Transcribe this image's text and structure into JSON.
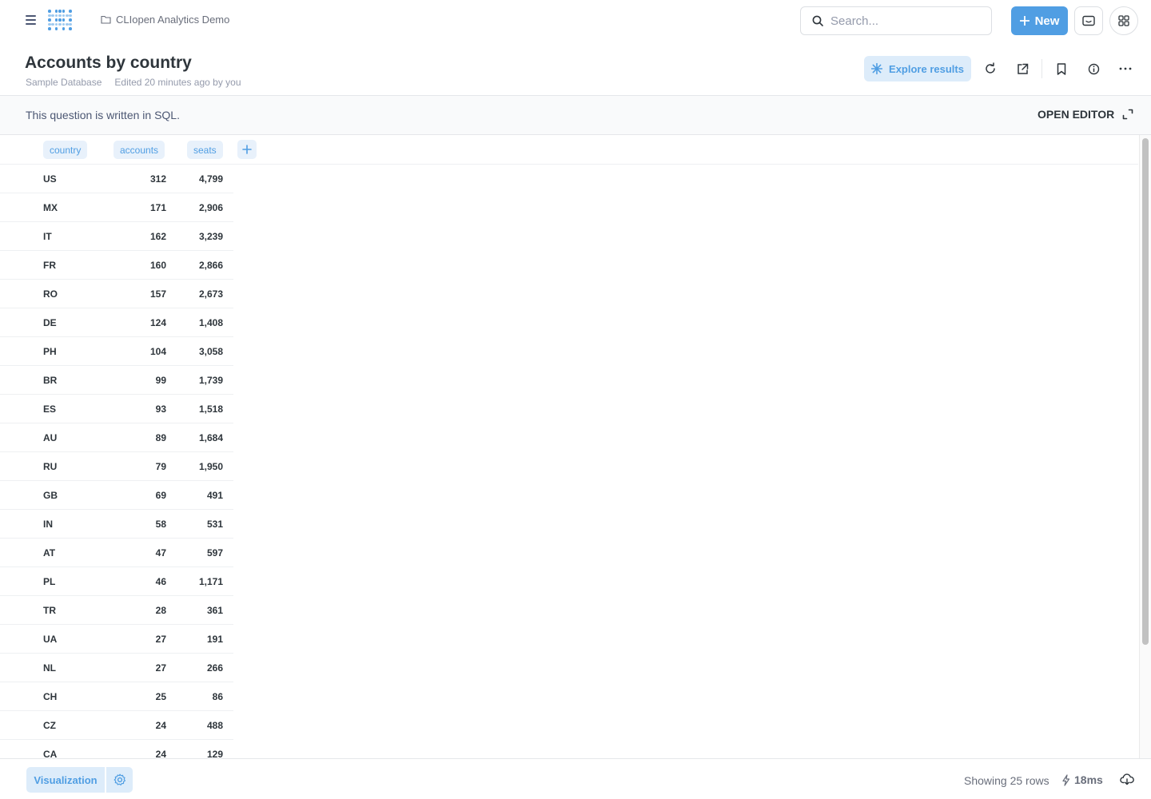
{
  "topbar": {
    "breadcrumb": "CLIopen Analytics Demo",
    "search_placeholder": "Search...",
    "new_label": "New"
  },
  "header": {
    "title": "Accounts by country",
    "database": "Sample Database",
    "edited": "Edited 20 minutes ago by you",
    "explore_label": "Explore results"
  },
  "sql_notice": {
    "text": "This question is written in SQL.",
    "open_editor": "OPEN EDITOR"
  },
  "table": {
    "columns": [
      "country",
      "accounts",
      "seats"
    ],
    "rows": [
      [
        "US",
        "312",
        "4,799"
      ],
      [
        "MX",
        "171",
        "2,906"
      ],
      [
        "IT",
        "162",
        "3,239"
      ],
      [
        "FR",
        "160",
        "2,866"
      ],
      [
        "RO",
        "157",
        "2,673"
      ],
      [
        "DE",
        "124",
        "1,408"
      ],
      [
        "PH",
        "104",
        "3,058"
      ],
      [
        "BR",
        "99",
        "1,739"
      ],
      [
        "ES",
        "93",
        "1,518"
      ],
      [
        "AU",
        "89",
        "1,684"
      ],
      [
        "RU",
        "79",
        "1,950"
      ],
      [
        "GB",
        "69",
        "491"
      ],
      [
        "IN",
        "58",
        "531"
      ],
      [
        "AT",
        "47",
        "597"
      ],
      [
        "PL",
        "46",
        "1,171"
      ],
      [
        "TR",
        "28",
        "361"
      ],
      [
        "UA",
        "27",
        "191"
      ],
      [
        "NL",
        "27",
        "266"
      ],
      [
        "CH",
        "25",
        "86"
      ],
      [
        "CZ",
        "24",
        "488"
      ],
      [
        "CA",
        "24",
        "129"
      ]
    ]
  },
  "footer": {
    "visualization_label": "Visualization",
    "row_count": "Showing 25 rows",
    "timing": "18ms"
  },
  "colors": {
    "brand": "#509ee3",
    "brand_light": "#ddecfa",
    "text_dark": "#2e353b",
    "text_medium": "#696e7b"
  }
}
